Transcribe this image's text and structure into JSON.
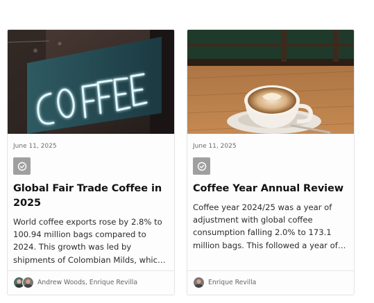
{
  "posts": [
    {
      "image": "coffee-neon-sign",
      "date": "June 11, 2025",
      "badge_icon": "check-circle-icon",
      "title": "Global Fair Trade Coffee in 2025",
      "excerpt": "World coffee exports rose by 2.8% to 100.94 million bags compared to 2024. This growth was led by shipments of Colombian Milds, which increased significantly.",
      "authors": "Andrew Woods, Enrique Revilla"
    },
    {
      "image": "latte-cup",
      "date": "June 11, 2025",
      "badge_icon": "check-circle-icon",
      "title": "Coffee Year Annual Review",
      "excerpt": "Coffee year 2024/25 was a year of adjustment with global coffee consumption falling 2.0% to 173.1 million bags. This followed a year of growth.",
      "authors": "Enrique Revilla"
    }
  ],
  "colors": {
    "badge": "#9f9f9f",
    "neon": "#c9f5ff",
    "title": "#121212"
  }
}
